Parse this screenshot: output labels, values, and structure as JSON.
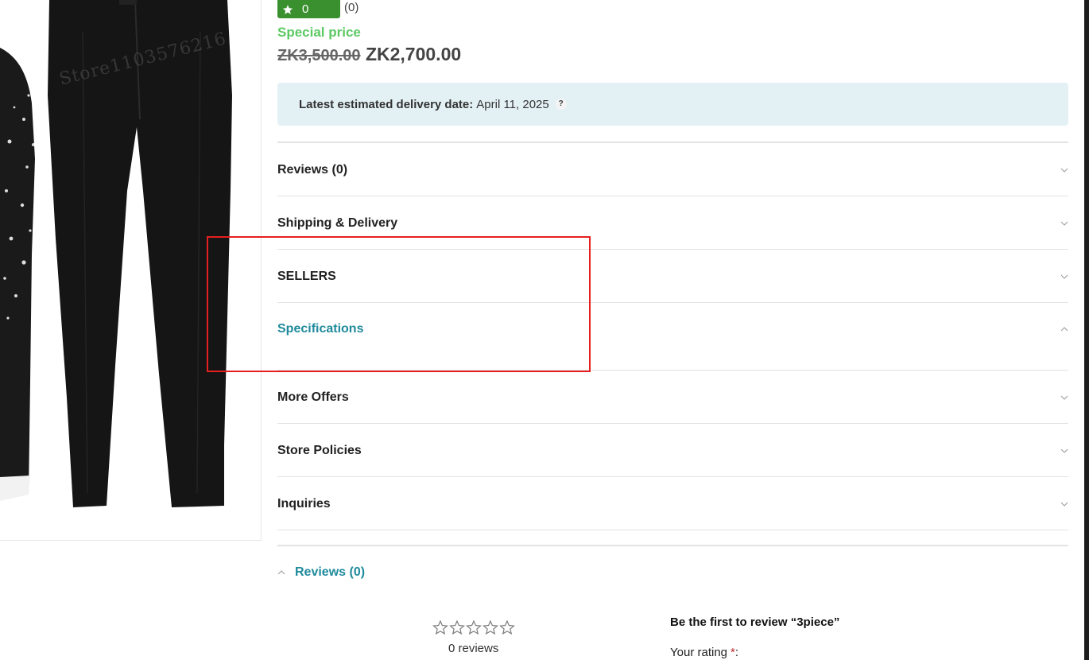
{
  "product": {
    "image_alt": "3piece black trousers product photo",
    "watermark_text": "Store1103576216"
  },
  "rating": {
    "score": "0",
    "count": "(0)",
    "badge_color": "#3a8f2e"
  },
  "price": {
    "special_label": "Special price",
    "old_price": "ZK3,500.00",
    "new_price": "ZK2,700.00",
    "special_color": "#5cc963"
  },
  "delivery": {
    "label": "Latest estimated delivery date:",
    "date": "April 11, 2025",
    "help_icon": "question-icon",
    "help_glyph": "?"
  },
  "accordion": {
    "items": [
      {
        "label": "Reviews (0)",
        "state": "collapsed"
      },
      {
        "label": "Shipping & Delivery",
        "state": "collapsed"
      },
      {
        "label": "SELLERS",
        "state": "collapsed"
      },
      {
        "label": "Specifications",
        "state": "expanded"
      },
      {
        "label": "More Offers",
        "state": "collapsed"
      },
      {
        "label": "Store Policies",
        "state": "collapsed"
      },
      {
        "label": "Inquiries",
        "state": "collapsed"
      }
    ],
    "active_color": "#1f8a9c"
  },
  "reviews_section": {
    "title": "Reviews (0)",
    "stars_total": 5,
    "stars_filled": 0,
    "count_text": "0 reviews",
    "form_title": "Be the first to review “3piece”",
    "your_rating_label": "Your rating",
    "required_mark": "*",
    "colon": ":"
  },
  "annotation": {
    "highlight_color": "#e51f1f"
  }
}
